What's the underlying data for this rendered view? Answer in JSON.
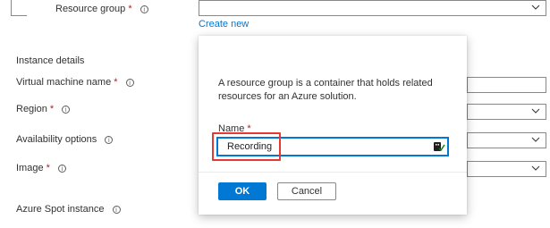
{
  "form": {
    "resource_group": {
      "label": "Resource group",
      "required_mark": "*",
      "info": "i",
      "create_new": "Create new"
    },
    "instance_details": {
      "heading": "Instance details"
    },
    "vm_name": {
      "label": "Virtual machine name",
      "required_mark": "*",
      "info": "i"
    },
    "region": {
      "label": "Region",
      "required_mark": "*",
      "info": "i"
    },
    "availability": {
      "label": "Availability options",
      "info": "i"
    },
    "image": {
      "label": "Image",
      "required_mark": "*",
      "info": "i"
    },
    "spot": {
      "label": "Azure Spot instance",
      "info": "i"
    }
  },
  "dialog": {
    "description": "A resource group is a container that holds related resources for an Azure solution.",
    "name_label": "Name",
    "name_required": "*",
    "name_value": "Recording",
    "ok_label": "OK",
    "cancel_label": "Cancel"
  },
  "colors": {
    "accent": "#0078d4",
    "required": "#a4262c",
    "highlight": "#e53935"
  },
  "icons": {
    "dropdown": "chevron-down-icon",
    "info": "info-icon",
    "key": "key-icon"
  }
}
